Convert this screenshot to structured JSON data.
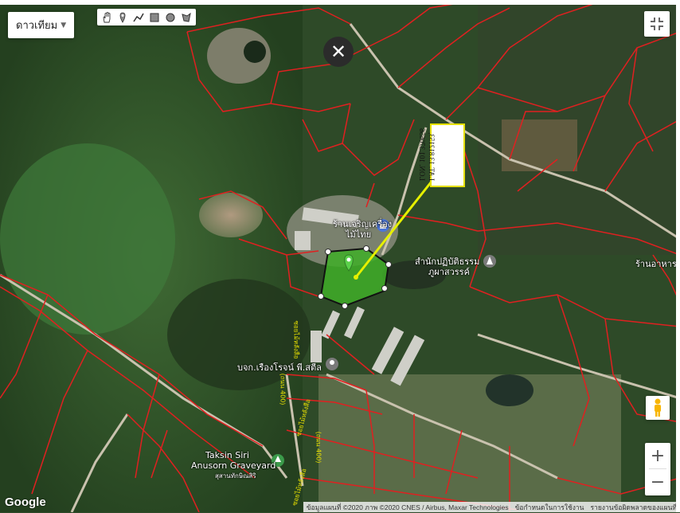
{
  "map": {
    "maptype_label": "ดาวเทียม",
    "colors": {
      "parcel_line": "#e02020",
      "polygon_fill": "#3fae28",
      "polygon_stroke": "#111111",
      "pointer_line": "#e6f000",
      "label_border": "#e5e000"
    },
    "coordinate_label": {
      "lat": "LAT. 13.812153,",
      "lon": "LON. 101.370656"
    },
    "labels": {
      "shop": "ร้านเจริญเครื่อง",
      "shop_sub": "ไม้ไทย",
      "temple": "สำนักปฏิบัติธรรม",
      "temple_sub": "ภูผาสวรรค์",
      "shop_right": "ร้านอาหาร",
      "company": "บจก.เรืองโรจน์ พี.สตีล",
      "grave_1": "Taksin Siri",
      "grave_2": "Anusorn Graveyard",
      "grave_3": "สุสานทักษิณสิริ",
      "road_1": "ซอยไม้หลังสือ",
      "road_2": "ซอยไม้หลังสือ",
      "road_3": "(ถนน 400)",
      "road_4": "(ถนน 400)",
      "road_5": "ซอยไม้หลังสือ"
    },
    "icons": [
      "hand-icon",
      "marker-icon",
      "polyline-icon",
      "rectangle-icon",
      "circle-icon",
      "polygon-icon",
      "close-icon",
      "fullscreen-icon",
      "pegman-icon",
      "shopping-bag-icon",
      "temple-icon",
      "place-pin-icon",
      "park-pin-icon"
    ],
    "zoom": {
      "plus": "+",
      "minus": "−"
    },
    "google_logo": "Google",
    "attribution": {
      "data": "ข้อมูลแผนที่ ©2020 ภาพ ©2020 CNES / Airbus, Maxar Technologies",
      "terms": "ข้อกำหนดในการใช้งาน",
      "report": "รายงานข้อผิดพลาดของแผนที่"
    }
  }
}
